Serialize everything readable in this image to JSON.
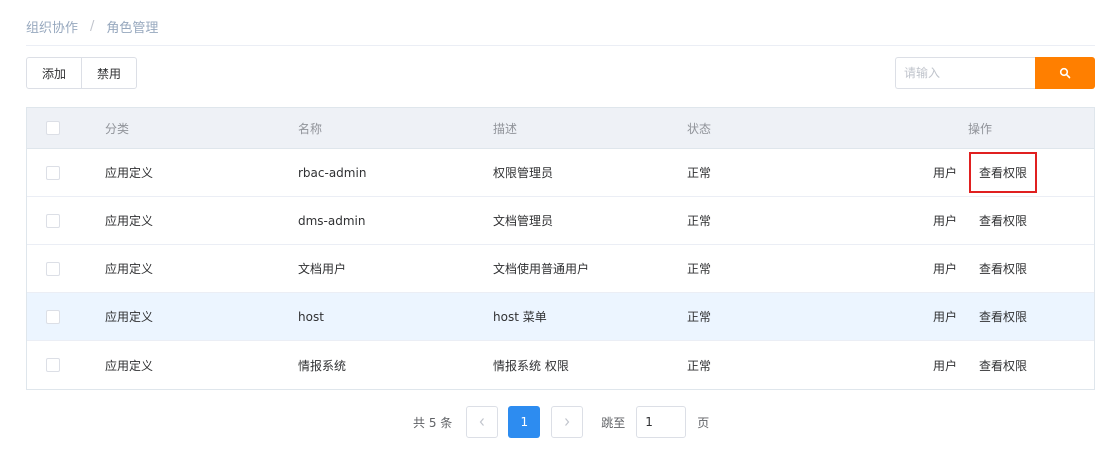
{
  "breadcrumb": {
    "parent": "组织协作",
    "separator": "/",
    "current": "角色管理"
  },
  "toolbar": {
    "add_label": "添加",
    "disable_label": "禁用"
  },
  "search": {
    "placeholder": "请输入",
    "icon": "search-icon"
  },
  "table": {
    "columns": {
      "category": "分类",
      "name": "名称",
      "description": "描述",
      "status": "状态",
      "actions": "操作"
    },
    "rows": [
      {
        "category": "应用定义",
        "name": "rbac-admin",
        "description": "权限管理员",
        "status": "正常",
        "user": "用户",
        "perm": "查看权限"
      },
      {
        "category": "应用定义",
        "name": "dms-admin",
        "description": "文档管理员",
        "status": "正常",
        "user": "用户",
        "perm": "查看权限"
      },
      {
        "category": "应用定义",
        "name": "文档用户",
        "description": "文档使用普通用户",
        "status": "正常",
        "user": "用户",
        "perm": "查看权限"
      },
      {
        "category": "应用定义",
        "name": "host",
        "description": "host 菜单",
        "status": "正常",
        "user": "用户",
        "perm": "查看权限"
      },
      {
        "category": "应用定义",
        "name": "情报系统",
        "description": "情报系统 权限",
        "status": "正常",
        "user": "用户",
        "perm": "查看权限"
      }
    ]
  },
  "pagination": {
    "total_label": "共 5 条",
    "current_page": "1",
    "jump_label": "跳至",
    "jump_value": "1",
    "page_suffix": "页"
  },
  "colors": {
    "accent": "#ff7f00",
    "page_active": "#2d8cf0",
    "highlight_box": "#e02020",
    "row_hover": "#ecf5ff"
  }
}
